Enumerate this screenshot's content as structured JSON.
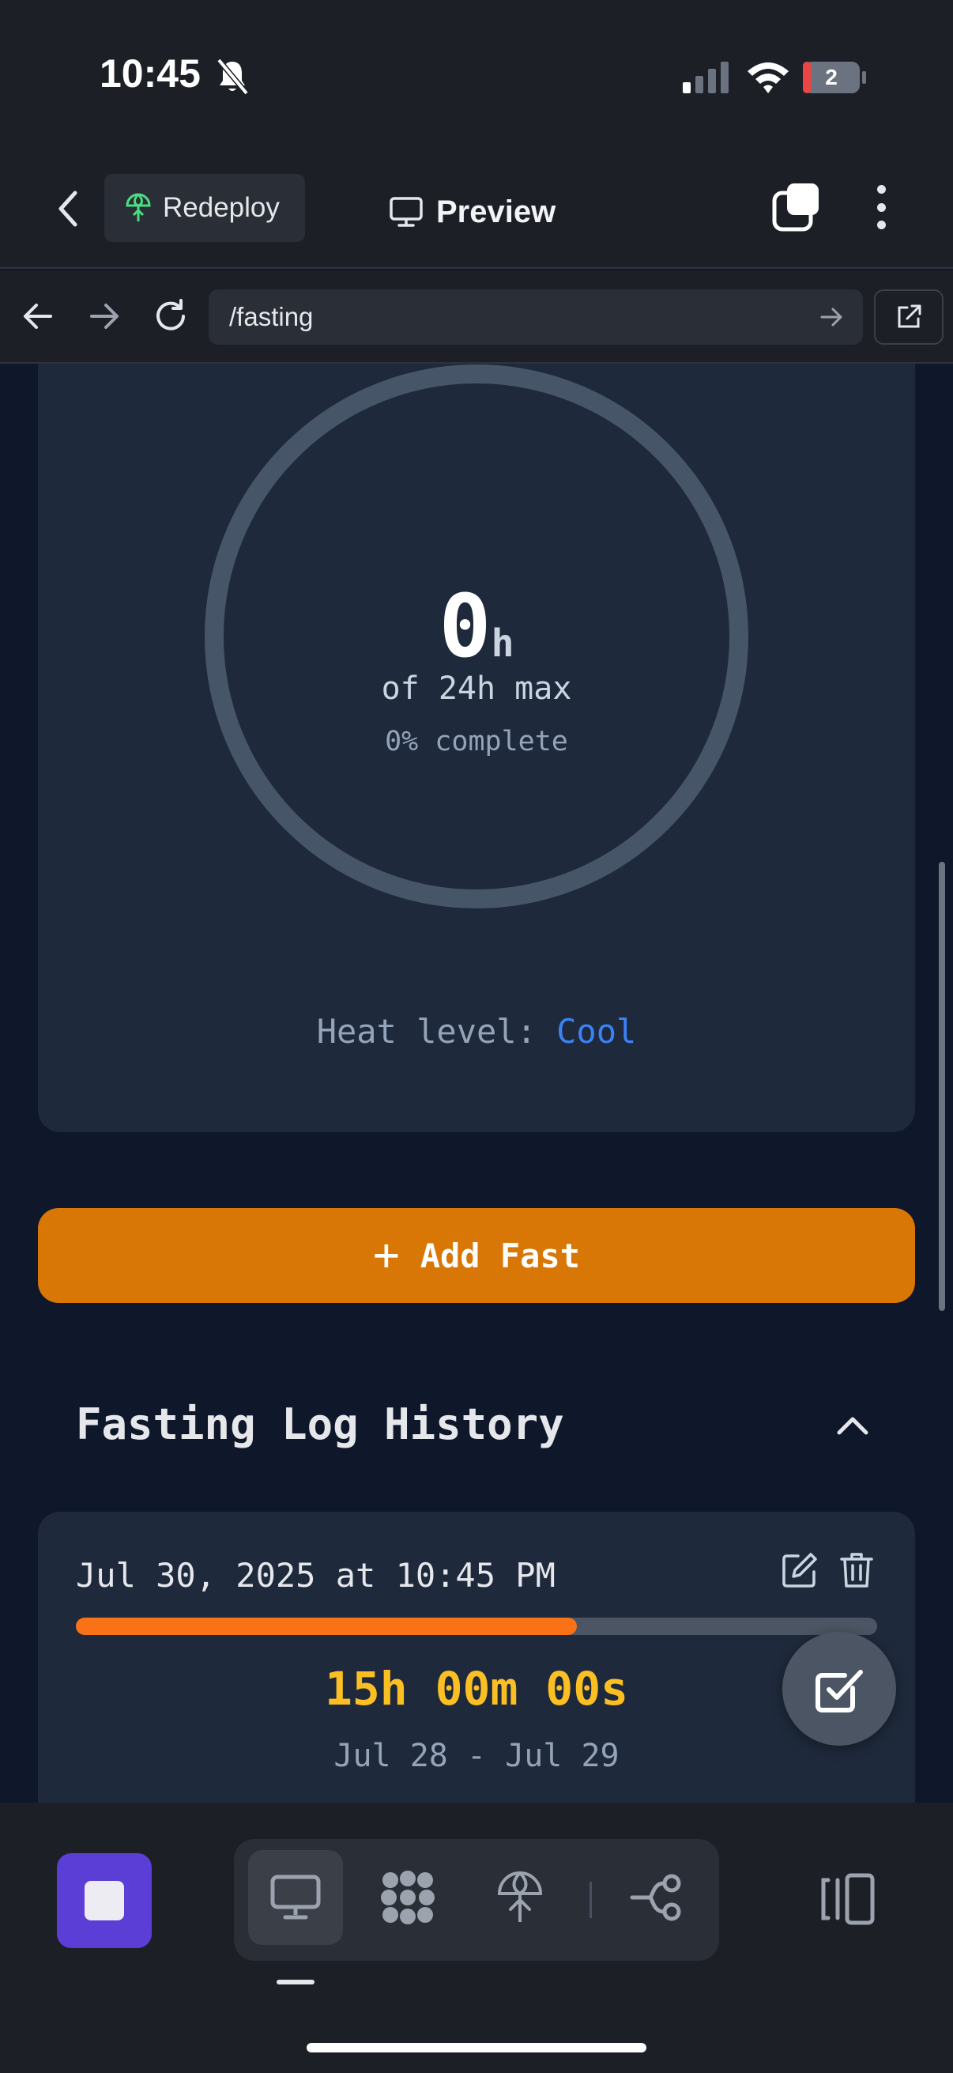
{
  "status_bar": {
    "time": "10:45",
    "battery": "2"
  },
  "topbar": {
    "redeploy_label": "Redeploy",
    "preview_label": "Preview"
  },
  "browser": {
    "url": "/fasting"
  },
  "timer": {
    "hours_value": "0",
    "hours_unit": "h",
    "max_text": "of 24h max",
    "percent_text": "0% complete",
    "progress": 0,
    "heat_label": "Heat level:",
    "heat_value": "Cool"
  },
  "actions": {
    "add_fast_label": "Add Fast"
  },
  "log": {
    "title": "Fasting Log History",
    "entries": [
      {
        "date": "Jul 30, 2025 at 10:45 PM",
        "progress": 0.625,
        "duration": "15h 00m 00s",
        "range": "Jul 28 - Jul 29"
      }
    ]
  },
  "colors": {
    "accent_orange": "#d97706",
    "progress_orange": "#f97316",
    "duration_yellow": "#fbbf24",
    "heat_blue": "#3b82f6",
    "stop_purple": "#5b3ed6",
    "ring_gray": "#475569"
  },
  "icons": [
    "bell-slash-icon",
    "signal-icon",
    "wifi-icon",
    "battery-icon",
    "chevron-left-icon",
    "redeploy-icon",
    "monitor-icon",
    "tabs-icon",
    "more-vertical-icon",
    "arrow-left-icon",
    "arrow-right-icon",
    "refresh-icon",
    "external-link-icon",
    "plus-icon",
    "chevron-up-icon",
    "edit-icon",
    "trash-icon",
    "check-square-icon",
    "stop-icon",
    "grid-icon",
    "deploy-icon",
    "branch-icon",
    "panels-icon"
  ]
}
